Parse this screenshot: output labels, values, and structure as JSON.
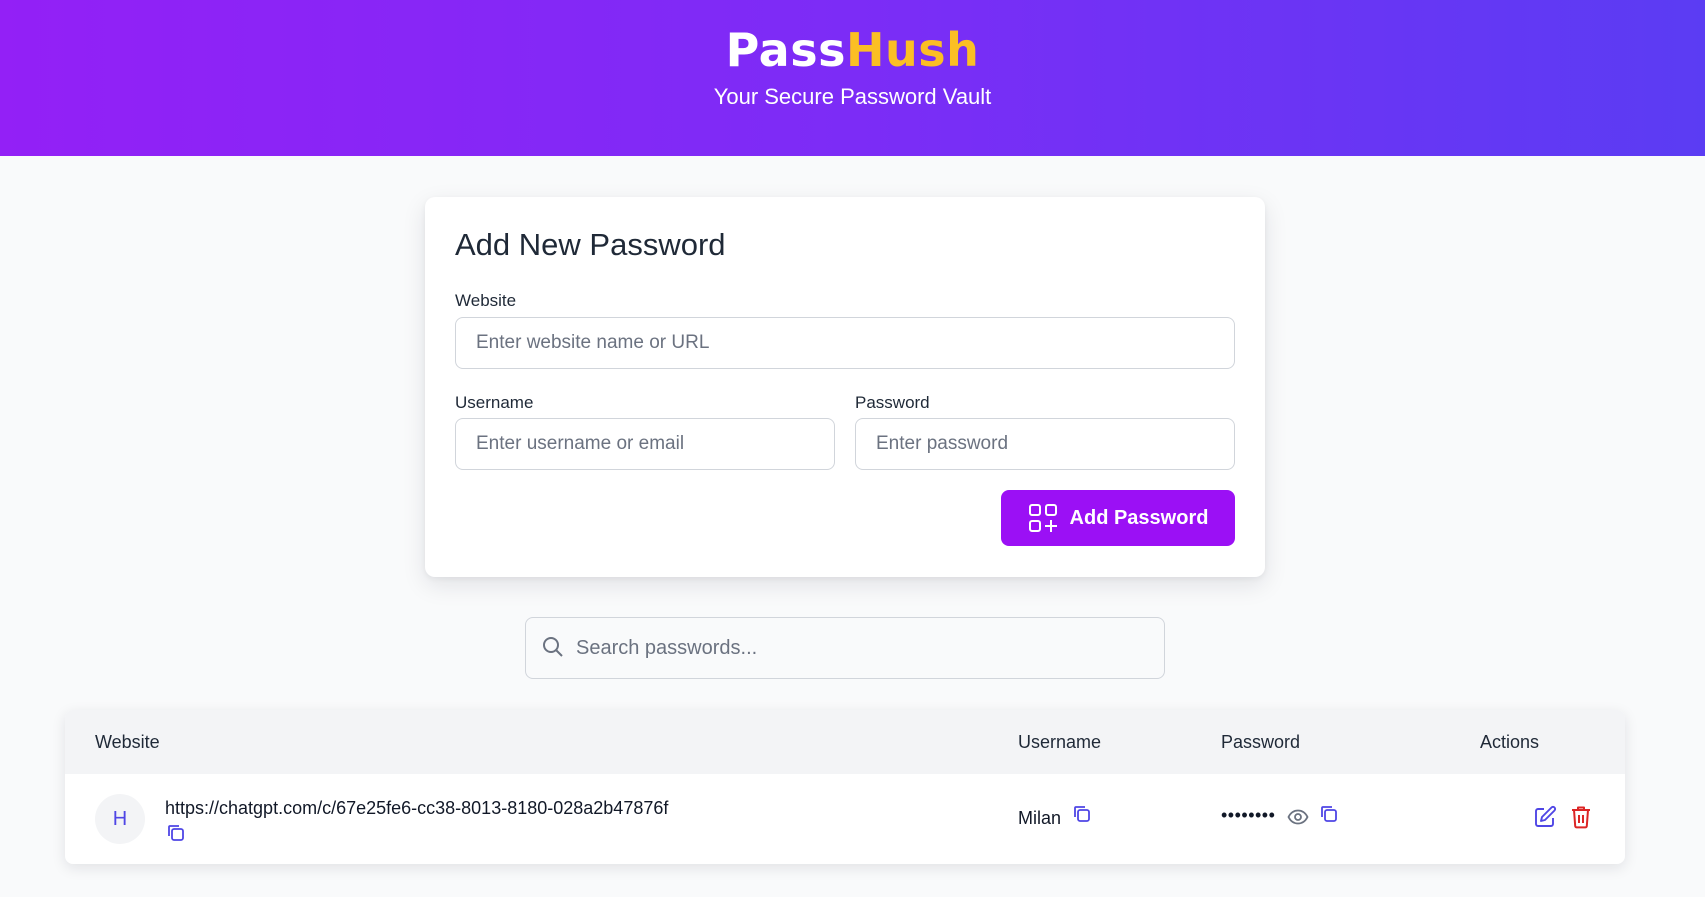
{
  "header": {
    "brand_part1": "Pass",
    "brand_part2": "Hush",
    "tagline": "Your Secure Password Vault",
    "brand_accent_color": "#fbbf24"
  },
  "form": {
    "title": "Add New Password",
    "website_label": "Website",
    "website_placeholder": "Enter website name or URL",
    "username_label": "Username",
    "username_placeholder": "Enter username or email",
    "password_label": "Password",
    "password_placeholder": "Enter password",
    "submit_label": "Add Password",
    "submit_icon": "grid-plus-icon",
    "submit_color": "#9b10f5"
  },
  "search": {
    "placeholder": "Search passwords...",
    "icon": "search-icon"
  },
  "table": {
    "columns": [
      "Website",
      "Username",
      "Password",
      "Actions"
    ],
    "rows": [
      {
        "avatar_letter": "H",
        "website": "https://chatgpt.com/c/67e25fe6-cc38-8013-8180-028a2b47876f",
        "username": "Milan",
        "password_masked": "••••••••",
        "icons": [
          "copy-icon",
          "eye-icon",
          "edit-icon",
          "trash-icon"
        ]
      }
    ]
  },
  "colors": {
    "header_gradient_start": "#9320f6",
    "header_gradient_end": "#5b3cf3",
    "icon_accent": "#4f46e5",
    "delete_color": "#dc2626"
  }
}
